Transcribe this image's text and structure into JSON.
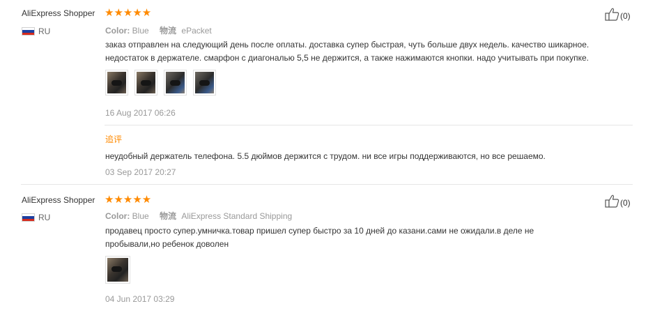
{
  "reviews": [
    {
      "user": "AliExpress Shopper",
      "country": "RU",
      "stars": "★★★★★",
      "color_label": "Color:",
      "color_value": "Blue",
      "shipping_label": "物流",
      "shipping_value": "ePacket",
      "text_lines": [
        "заказ отправлен на следующий день после оплаты. доставка супер быстрая, чуть больше двух недель. качество шикарное.",
        "недостаток в держателе. смарфон с диагональю 5,5 не держится, а также нажимаются кнопки. надо учитывать при покупке."
      ],
      "date": "16 Aug 2017 06:26",
      "followup_label": "追评",
      "followup_text": "неудобный держатель телефона. 5.5 дюймов держится с трудом. ни все игры поддерживаются, но все решаемо.",
      "followup_date": "03 Sep 2017 20:27",
      "helpful_count": "(0)",
      "photo_count": 4
    },
    {
      "user": "AliExpress Shopper",
      "country": "RU",
      "stars": "★★★★★",
      "color_label": "Color:",
      "color_value": "Blue",
      "shipping_label": "物流",
      "shipping_value": "AliExpress Standard Shipping",
      "text_lines": [
        "продавец просто супер.умничка.товар пришел супер быстро за 10 дней до казани.сами не ожидали.в деле не",
        "пробывали,но ребенок доволен"
      ],
      "date": "04 Jun 2017 03:29",
      "helpful_count": "(0)",
      "photo_count": 1
    }
  ],
  "icons": {
    "flag": "russia-flag-icon",
    "stars": "star-rating-icon",
    "helpful": "thumbs-up-icon"
  },
  "colors": {
    "star": "#ff8a00",
    "followup_label": "#ff8a00",
    "muted_text": "#999999",
    "body_text": "#333333"
  }
}
